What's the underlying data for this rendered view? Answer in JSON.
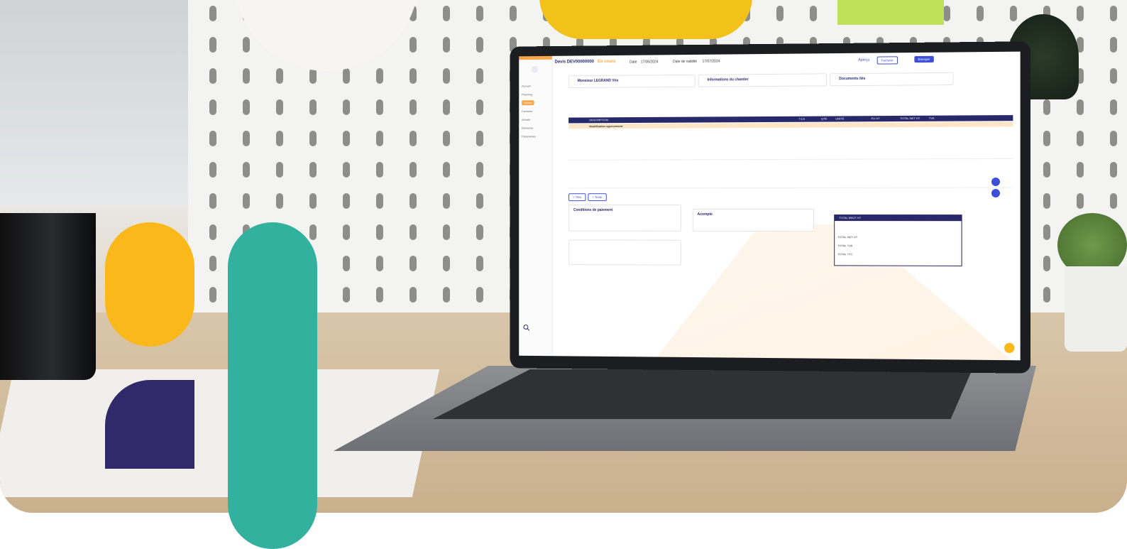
{
  "screen": {
    "quote_title": "Devis DEV00000000",
    "status": "En cours",
    "date_label": "Date",
    "date_value": "17/06/2024",
    "validity_label": "Date de validité",
    "validity_value": "17/07/2024",
    "btn_apercu": "Aperçu",
    "btn_facturer": "Facturer",
    "btn_envoyer": "Envoyer",
    "client_name": "Monsieur LEGRAND Véa",
    "chantier_label": "Informations du chantier",
    "documents_label": "Documents liés",
    "sidebar": [
      "Accueil",
      "Planning",
      "Ventes",
      "Factures",
      "Achats",
      "Éléments",
      "Paramètres"
    ],
    "table_headers": [
      "DESCRIPTION",
      "T.V.A",
      "QTÉ",
      "UNITÉ",
      "PU HT",
      "TOTAL NET HT",
      "TVA"
    ],
    "section_title": "Modification agencement",
    "btn_titre": "+ Titre",
    "btn_texte": "+ Texte",
    "conditions_title": "Conditions de paiement",
    "acompte_title": "Acompte",
    "totals_header": "TOTAL BRUT HT",
    "totals_lines": [
      "TOTAL NET HT",
      "TOTAL TVA",
      "TOTAL TTC"
    ]
  },
  "colors": {
    "yellow": "#fbb81a",
    "purple": "#302a6a",
    "green": "#32b19f",
    "navy": "#27296b",
    "orange": "#f7a64a"
  }
}
